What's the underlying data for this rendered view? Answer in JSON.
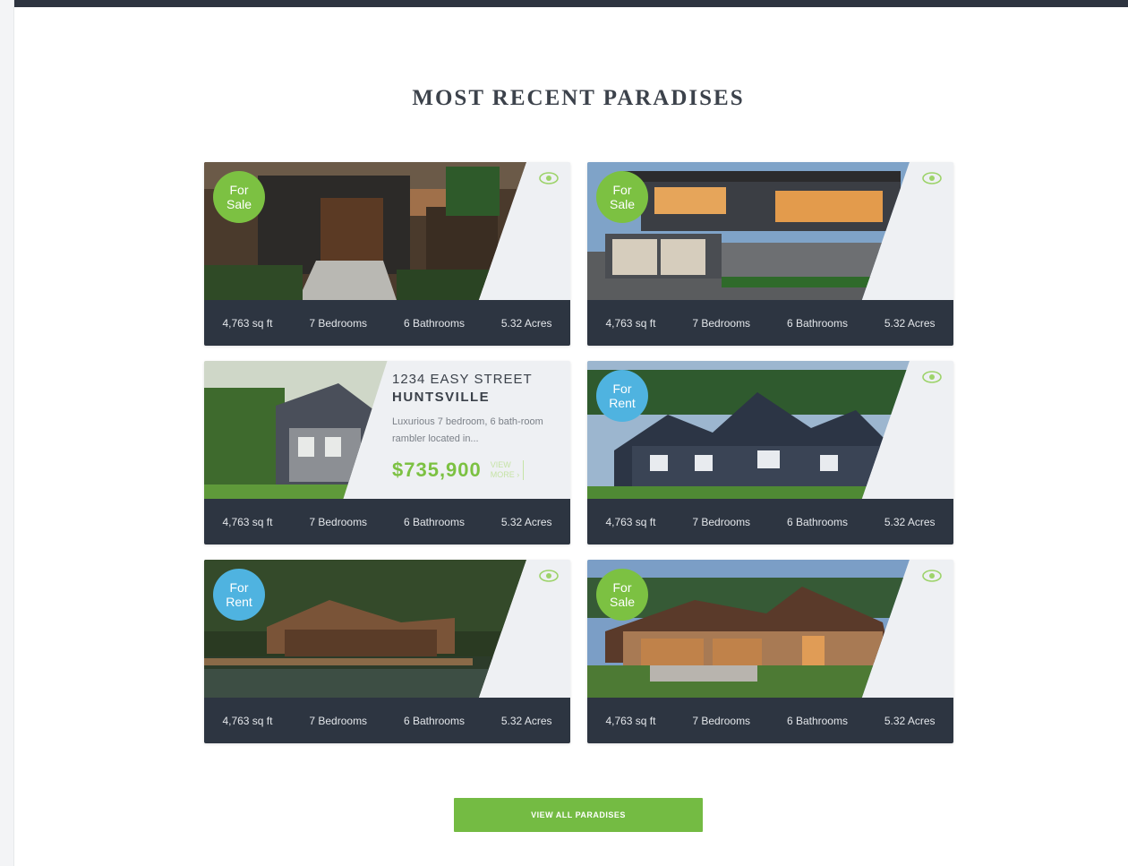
{
  "section": {
    "title": "MOST RECENT PARADISES"
  },
  "colors": {
    "sale_green": "#7cc142",
    "rent_blue": "#4fb3e0",
    "stats_bg": "#2d3541",
    "top_bar": "#2e3440"
  },
  "listings": [
    {
      "badge_line1": "For",
      "badge_line2": "Sale",
      "badge_type": "sale",
      "icon": "eye-icon",
      "sqft": "4,763 sq ft",
      "bedrooms": "7 Bedrooms",
      "bathrooms": "6 Bathrooms",
      "acres": "5.32 Acres"
    },
    {
      "badge_line1": "For",
      "badge_line2": "Sale",
      "badge_type": "sale",
      "icon": "eye-icon",
      "sqft": "4,763 sq ft",
      "bedrooms": "7 Bedrooms",
      "bathrooms": "6 Bathrooms",
      "acres": "5.32 Acres"
    },
    {
      "address": "1234 EASY STREET",
      "city": "HUNTSVILLE",
      "description": "Luxurious 7 bedroom, 6 bath-room rambler located in...",
      "price": "$735,900",
      "more_line1": "VIEW",
      "more_line2": "MORE ›",
      "sqft": "4,763 sq ft",
      "bedrooms": "7 Bedrooms",
      "bathrooms": "6 Bathrooms",
      "acres": "5.32 Acres"
    },
    {
      "badge_line1": "For",
      "badge_line2": "Rent",
      "badge_type": "rent",
      "icon": "eye-icon",
      "sqft": "4,763 sq ft",
      "bedrooms": "7 Bedrooms",
      "bathrooms": "6 Bathrooms",
      "acres": "5.32 Acres"
    },
    {
      "badge_line1": "For",
      "badge_line2": "Rent",
      "badge_type": "rent",
      "icon": "eye-icon",
      "sqft": "4,763 sq ft",
      "bedrooms": "7 Bedrooms",
      "bathrooms": "6 Bathrooms",
      "acres": "5.32 Acres"
    },
    {
      "badge_line1": "For",
      "badge_line2": "Sale",
      "badge_type": "sale",
      "icon": "eye-icon",
      "sqft": "4,763 sq ft",
      "bedrooms": "7 Bedrooms",
      "bathrooms": "6 Bathrooms",
      "acres": "5.32 Acres"
    }
  ],
  "cta": {
    "label": "VIEW ALL PARADISES"
  }
}
